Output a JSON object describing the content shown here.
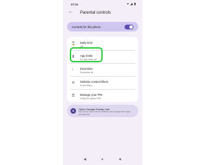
{
  "status_bar": {
    "time": "10:56",
    "icons": "▾ ◢ ▮"
  },
  "app_bar": {
    "back_icon": "arrow-back-icon",
    "title": "Parental controls"
  },
  "toggle": {
    "label": "Controls for this phone",
    "on": true
  },
  "list": [
    {
      "icon": "hourglass-icon",
      "title": "Daily limit",
      "subtitle": "Off"
    },
    {
      "icon": "app-limits-icon",
      "title": "App limits",
      "subtitle": "No app limits set"
    },
    {
      "icon": "downtime-icon",
      "title": "Downtime",
      "subtitle": "Downtime off"
    },
    {
      "icon": "filter-icon",
      "title": "Website content filters",
      "subtitle": "Some filters"
    },
    {
      "icon": "key-icon",
      "title": "Manage your PIN",
      "subtitle": "Verify the parent PIN"
    }
  ],
  "family_link": {
    "icon": "family-link-icon",
    "title": "Open Google Family Link",
    "subtitle": "Set screen time limits for children and manage their apps and devices"
  },
  "navbar": {
    "back": "◀",
    "home": "●",
    "recent": "■"
  },
  "colors": {
    "accent": "#5b4fb0",
    "highlight": "#2ecc40",
    "card": "#cfc7ef",
    "background": "#f3eef8"
  }
}
